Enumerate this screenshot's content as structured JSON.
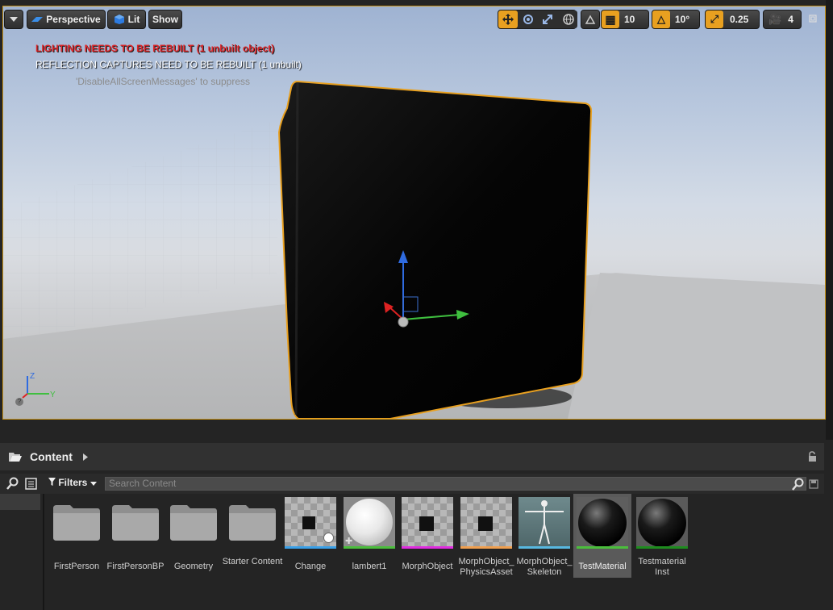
{
  "viewport": {
    "perspective_label": "Perspective",
    "lit_label": "Lit",
    "show_label": "Show",
    "grid_snap": "10",
    "rotation_snap": "10°",
    "scale_snap": "0.25",
    "camera_speed": "4",
    "messages": {
      "lighting": "LIGHTING NEEDS TO BE REBUILT (1 unbuilt object)",
      "reflection": "REFLECTION CAPTURES NEED TO BE REBUILT (1 unbuilt)",
      "suppress": "'DisableAllScreenMessages' to suppress"
    },
    "axis_z": "Z",
    "axis_y": "Y",
    "accent_color": "#e8a020"
  },
  "content_browser": {
    "title": "Content",
    "filters_label": "Filters",
    "search_placeholder": "Search Content",
    "assets": [
      {
        "label": "FirstPerson",
        "type": "folder"
      },
      {
        "label": "FirstPersonBP",
        "type": "folder"
      },
      {
        "label": "Geometry",
        "type": "folder"
      },
      {
        "label": "Starter Content",
        "type": "folder"
      },
      {
        "label": "Change",
        "type": "static-mesh",
        "bar_color": "#3aa0e8"
      },
      {
        "label": "lambert1",
        "type": "material",
        "bar_color": "#4bbe3c"
      },
      {
        "label": "MorphObject",
        "type": "skeletal-mesh",
        "bar_color": "#e02ce0"
      },
      {
        "label": "MorphObject_ PhysicsAsset",
        "type": "physics-asset",
        "bar_color": "#f0a050"
      },
      {
        "label": "MorphObject_ Skeleton",
        "type": "skeleton",
        "bar_color": "#58b8e0"
      },
      {
        "label": "TestMaterial",
        "type": "material",
        "bar_color": "#4bbe3c",
        "selected": true
      },
      {
        "label": "Testmaterial Inst",
        "type": "material-instance",
        "bar_color": "#1e8c1e"
      }
    ]
  }
}
